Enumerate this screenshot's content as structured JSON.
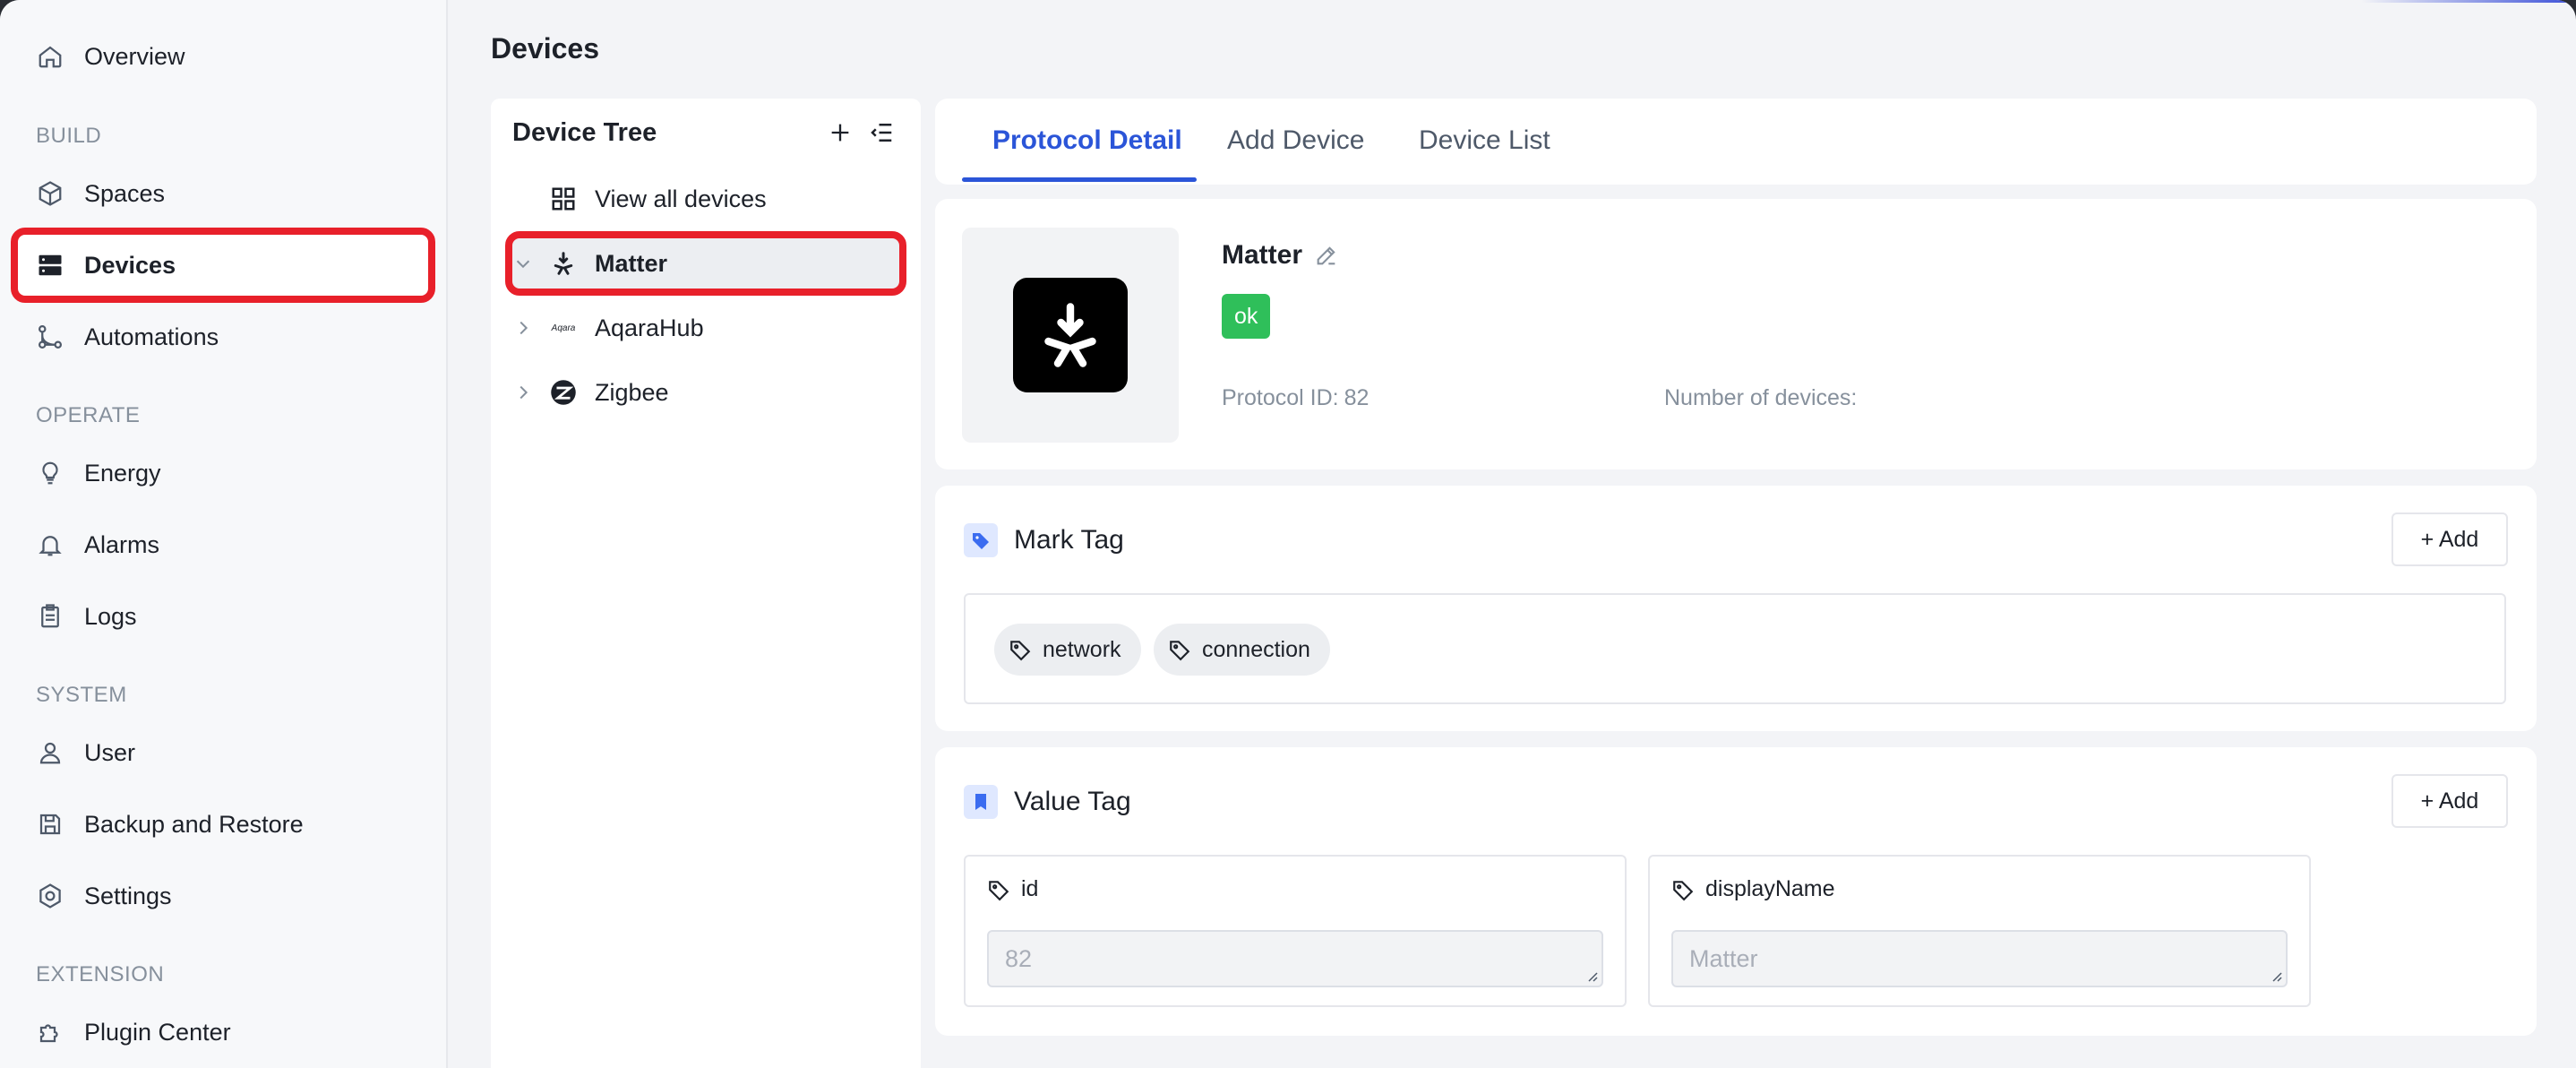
{
  "sidebar": {
    "items": [
      {
        "label": "Overview",
        "icon": "home-icon"
      },
      {
        "label": "Spaces",
        "icon": "cube-icon"
      },
      {
        "label": "Devices",
        "icon": "server-icon"
      },
      {
        "label": "Automations",
        "icon": "flow-icon"
      },
      {
        "label": "Energy",
        "icon": "bulb-icon"
      },
      {
        "label": "Alarms",
        "icon": "bell-icon"
      },
      {
        "label": "Logs",
        "icon": "clipboard-icon"
      },
      {
        "label": "User",
        "icon": "user-icon"
      },
      {
        "label": "Backup and Restore",
        "icon": "save-icon"
      },
      {
        "label": "Settings",
        "icon": "gear-icon"
      },
      {
        "label": "Plugin Center",
        "icon": "puzzle-icon"
      }
    ],
    "sections": [
      "BUILD",
      "OPERATE",
      "SYSTEM",
      "EXTENSION"
    ],
    "active": "Devices"
  },
  "header": {
    "title": "Devices"
  },
  "tree": {
    "title": "Device Tree",
    "rows": [
      {
        "label": "View all devices"
      },
      {
        "label": "Matter"
      },
      {
        "label": "AqaraHub",
        "icon_text": "Aqara"
      },
      {
        "label": "Zigbee"
      }
    ]
  },
  "tabs": [
    "Protocol Detail",
    "Add Device",
    "Device List"
  ],
  "protocol": {
    "name": "Matter",
    "status": "ok",
    "id_label": "Protocol ID:",
    "id_value": "82",
    "devices_label": "Number of devices:",
    "devices_value": ""
  },
  "mark_tag": {
    "title": "Mark Tag",
    "add_label": "+ Add",
    "tags": [
      "network",
      "connection"
    ]
  },
  "value_tag": {
    "title": "Value Tag",
    "add_label": "+ Add",
    "fields": [
      {
        "label": "id",
        "value": "82"
      },
      {
        "label": "displayName",
        "value": "Matter"
      }
    ]
  },
  "colors": {
    "accent": "#2b55d8",
    "status_ok": "#2fbf5a",
    "highlight": "#e8202a"
  }
}
